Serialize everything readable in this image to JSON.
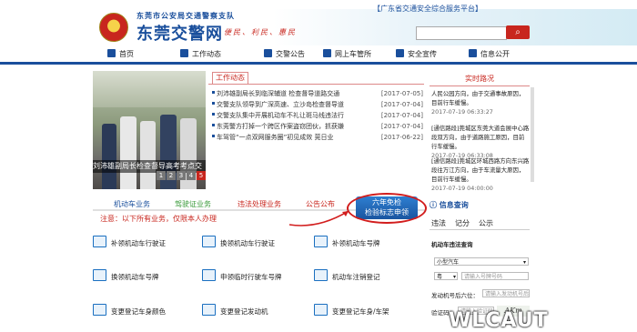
{
  "header": {
    "top_link": "【广东省交通安全综合服务平台】",
    "org_small": "东莞市公安局交通警察支队",
    "org_big": "东莞交警网",
    "slogan": "便民、利民、惠民"
  },
  "nav": {
    "items": [
      "首页",
      "工作动态",
      "交警公告",
      "网上车管所",
      "安全宣传",
      "信息公开"
    ]
  },
  "slideshow": {
    "caption": "刘沛雄副局长检查督导高考考点交",
    "pages": [
      "1",
      "2",
      "3",
      "4",
      "5"
    ],
    "active_page": "5"
  },
  "news": {
    "tab": "工作动态",
    "items": [
      {
        "title": "刘沛雄副局长到临深辅道 检查督导道路交通",
        "date": "[2017-07-05]"
      },
      {
        "title": "交警支队领导到广深高速、立沙岛检查督导道",
        "date": "[2017-07-04]"
      },
      {
        "title": "交警支队集中开展机动车不礼让斑马线违法行",
        "date": "[2017-07-04]"
      },
      {
        "title": "东莞警方打掉一个跨区作案盗窃团伙，抓获嫌",
        "date": "[2017-07-04]"
      },
      {
        "title": "车驾管“一点双网服务圈”初见成效 莞日业",
        "date": "[2017-06-22]"
      }
    ]
  },
  "traffic": {
    "title": "实时路况",
    "items": [
      {
        "text": "人民公园方向，由于交通事故原因，目前行车缓慢。",
        "time": "2017-07-19 06:33:27"
      },
      {
        "text": "[通信路段]莞城区东莞大道会展中心路段双方向，由于道路施工原因，目前行车缓慢。",
        "time": "2017-07-19 06:33:08"
      },
      {
        "text": "[通信路段]莞城区环城西路方向东兴路段往万江方向，由于车流量大原因，目前行车缓慢。",
        "time": "2017-07-19 04:00:00"
      }
    ]
  },
  "business": {
    "tabs": [
      "机动车业务",
      "驾驶证业务",
      "违法处理业务",
      "公告公布"
    ],
    "notice": "注意：以下所有业务，仅限本人办理",
    "exempt_line1": "六年免检",
    "exempt_line2": "检验标志申领",
    "services": [
      "补领机动车行驶证",
      "换领机动车行驶证",
      "补领机动车号牌",
      "换领机动车号牌",
      "申领临时行驶车号牌",
      "机动车注销登记",
      "变更登记车身颜色",
      "变更登记发动机",
      "变更登记车身/车架"
    ]
  },
  "query": {
    "title": "信息查询",
    "tabs": [
      "违法",
      "记分",
      "公示"
    ],
    "section": "机动车违法查询",
    "vehicle_type": "小型汽车",
    "province": "粤",
    "plate_placeholder": "请输入号牌号码",
    "engine_label": "发动机号后六位：",
    "engine_placeholder": "请输入发动机号后",
    "captcha_label": "验证码：",
    "captcha_placeholder": "请输入验证码",
    "captcha_text": "AKm"
  },
  "watermark": "WLCAUT",
  "colors": {
    "brand_blue": "#1a4f9c",
    "accent_red": "#c8261e",
    "highlight_ring": "#d21d1d"
  }
}
